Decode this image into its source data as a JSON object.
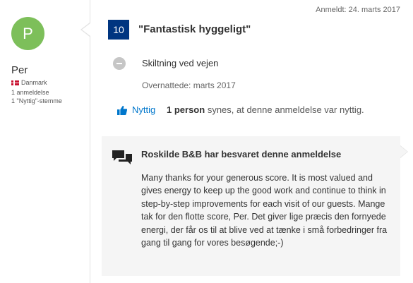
{
  "reviewer": {
    "avatar_letter": "P",
    "name": "Per",
    "country": "Danmark",
    "reviews_count": "1 anmeldelse",
    "helpful_votes": "1 \"Nyttig\"-stemme"
  },
  "review": {
    "date": "Anmeldt: 24. marts 2017",
    "score": "10",
    "title": "\"Fantastisk hyggeligt\"",
    "negative": "Skiltning ved vejen",
    "stayed": "Overnattede: marts 2017"
  },
  "helpful": {
    "link_label": "Nyttig",
    "count": "1 person",
    "suffix": "synes, at denne anmeldelse var nyttig."
  },
  "response": {
    "title": "Roskilde B&B har besvaret denne anmeldelse",
    "body": "Many thanks for your generous score. It is most valued and gives energy to keep up the good work and continue to think in step-by-step improvements for each visit of our guests. Mange tak for den flotte score, Per. Det giver lige præcis den fornyede energi, der får os til at blive ved at tænke i små forbedringer fra gang til gang for vores besøgende;-)"
  },
  "colors": {
    "score_badge": "#003580",
    "avatar_bg": "#7dbf5a",
    "link": "#0077cc",
    "response_bg": "#f5f5f5"
  }
}
